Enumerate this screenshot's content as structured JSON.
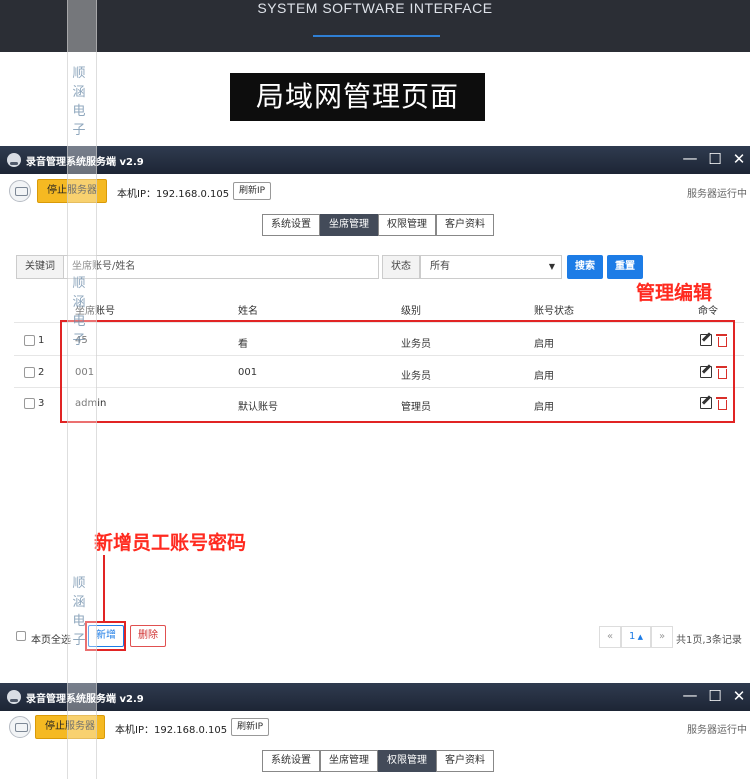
{
  "banner": {
    "title": "SYSTEM SOFTWARE INTERFACE"
  },
  "heading": "局域网管理页面",
  "window1": {
    "title": "录音管理系统服务端 v2.9",
    "stop_button": "停止服务器",
    "ip_label": "本机IP：192.168.0.105",
    "refresh_button": "刷新IP",
    "server_status": "服务器运行中",
    "tabs": [
      "系统设置",
      "坐席管理",
      "权限管理",
      "客户资料"
    ],
    "active_tab": "坐席管理",
    "filter": {
      "keyword_label": "关键词",
      "keyword_placeholder": "坐席账号/姓名",
      "status_label": "状态",
      "status_value": "所有",
      "search_button": "搜索",
      "reset_button": "重置"
    },
    "table": {
      "headers": [
        "坐席账号",
        "姓名",
        "级别",
        "账号状态",
        "命令"
      ],
      "rows": [
        {
          "index": "1",
          "account": "45",
          "name": "看",
          "level": "业务员",
          "status": "启用"
        },
        {
          "index": "2",
          "account": "001",
          "name": "001",
          "level": "业务员",
          "status": "启用"
        },
        {
          "index": "3",
          "account": "admin",
          "name": "默认账号",
          "level": "管理员",
          "status": "启用"
        }
      ]
    },
    "footer": {
      "select_all": "本页全选",
      "add_button": "新增",
      "delete_button": "删除",
      "pager_prev": "«",
      "pager_current": "1",
      "pager_next": "»",
      "pager_summary": "共1页,3条记录"
    }
  },
  "annotations": {
    "manage_edit": "管理编辑",
    "add_staff": "新增员工账号密码"
  },
  "window2": {
    "title": "录音管理系统服务端 v2.9",
    "stop_button": "停止服务器",
    "ip_label": "本机IP：192.168.0.105",
    "refresh_button": "刷新IP",
    "server_status": "服务器运行中",
    "tabs": [
      "系统设置",
      "坐席管理",
      "权限管理",
      "客户资料"
    ],
    "active_tab": "权限管理"
  },
  "watermark": [
    "顺涵电子",
    "顺涵电子",
    "顺涵电子"
  ],
  "colors": {
    "accent_blue": "#1d7ce6",
    "stop_yellow": "#f5b922",
    "annotation_red": "#e12424",
    "titlebar": "#1d2535"
  }
}
